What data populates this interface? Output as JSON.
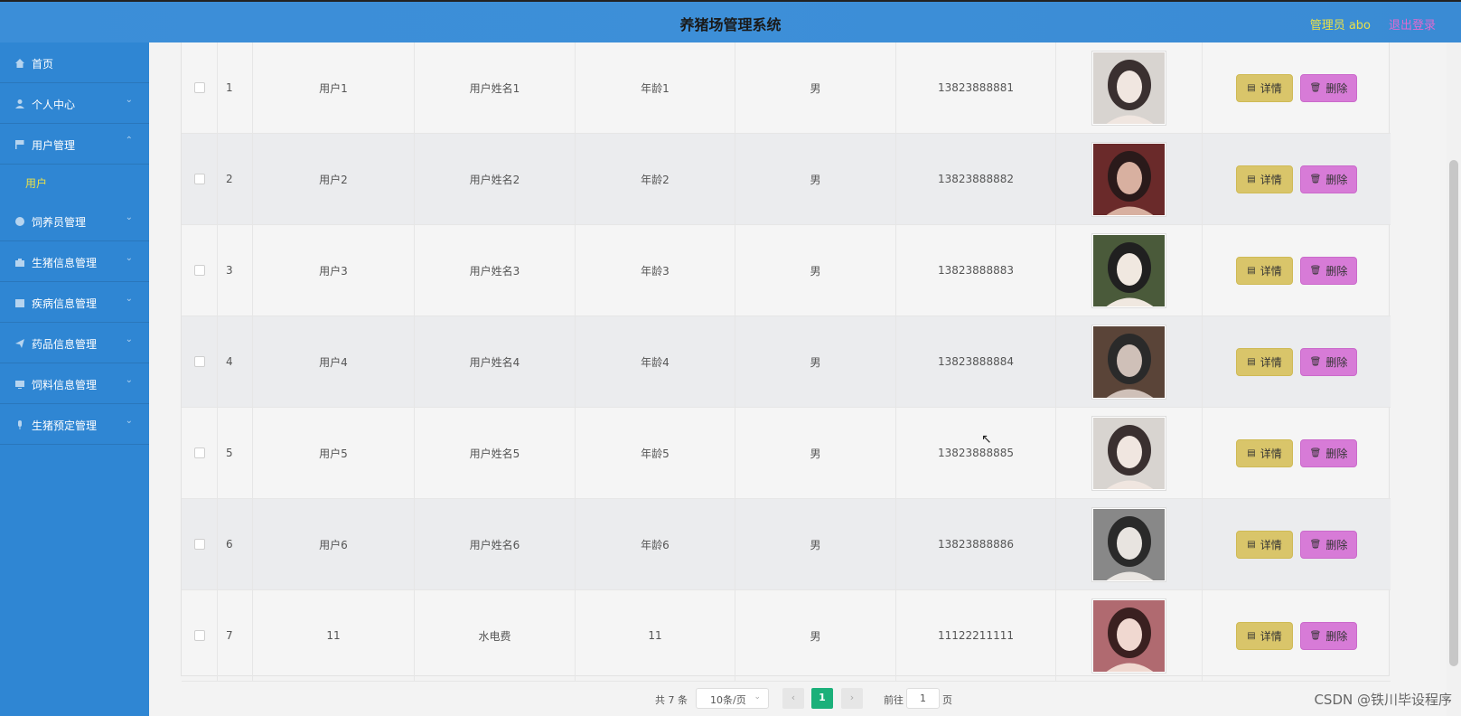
{
  "header": {
    "title": "养猪场管理系统",
    "admin": "管理员 abo",
    "logout": "退出登录"
  },
  "sidebar": {
    "items": [
      {
        "label": "首页",
        "icon": "home-icon",
        "arrow": ""
      },
      {
        "label": "个人中心",
        "icon": "person-icon",
        "arrow": "⌄"
      },
      {
        "label": "用户管理",
        "icon": "flag-icon",
        "arrow": "⌃"
      },
      {
        "label": "饲养员管理",
        "icon": "info-icon",
        "arrow": "⌄"
      },
      {
        "label": "生猪信息管理",
        "icon": "briefcase-icon",
        "arrow": "⌄"
      },
      {
        "label": "疾病信息管理",
        "icon": "calendar-icon",
        "arrow": "⌄"
      },
      {
        "label": "药品信息管理",
        "icon": "send-icon",
        "arrow": "⌄"
      },
      {
        "label": "饲料信息管理",
        "icon": "monitor-icon",
        "arrow": "⌄"
      },
      {
        "label": "生猪预定管理",
        "icon": "mic-icon",
        "arrow": "⌄"
      }
    ],
    "submenu": "用户"
  },
  "table": {
    "rows": [
      {
        "idx": "1",
        "account": "用户1",
        "name": "用户姓名1",
        "age": "年龄1",
        "sex": "男",
        "phone": "13823888881"
      },
      {
        "idx": "2",
        "account": "用户2",
        "name": "用户姓名2",
        "age": "年龄2",
        "sex": "男",
        "phone": "13823888882"
      },
      {
        "idx": "3",
        "account": "用户3",
        "name": "用户姓名3",
        "age": "年龄3",
        "sex": "男",
        "phone": "13823888883"
      },
      {
        "idx": "4",
        "account": "用户4",
        "name": "用户姓名4",
        "age": "年龄4",
        "sex": "男",
        "phone": "13823888884"
      },
      {
        "idx": "5",
        "account": "用户5",
        "name": "用户姓名5",
        "age": "年龄5",
        "sex": "男",
        "phone": "13823888885"
      },
      {
        "idx": "6",
        "account": "用户6",
        "name": "用户姓名6",
        "age": "年龄6",
        "sex": "男",
        "phone": "13823888886"
      },
      {
        "idx": "7",
        "account": "11",
        "name": "水电费",
        "age": "11",
        "sex": "男",
        "phone": "11122211111"
      }
    ],
    "detail_label": "详情",
    "delete_label": "删除"
  },
  "pager": {
    "total": "共 7 条",
    "size": "10条/页",
    "current": "1",
    "goto": "前往",
    "goto_value": "1",
    "page": "页"
  },
  "watermark": "CSDN @铁川毕设程序"
}
